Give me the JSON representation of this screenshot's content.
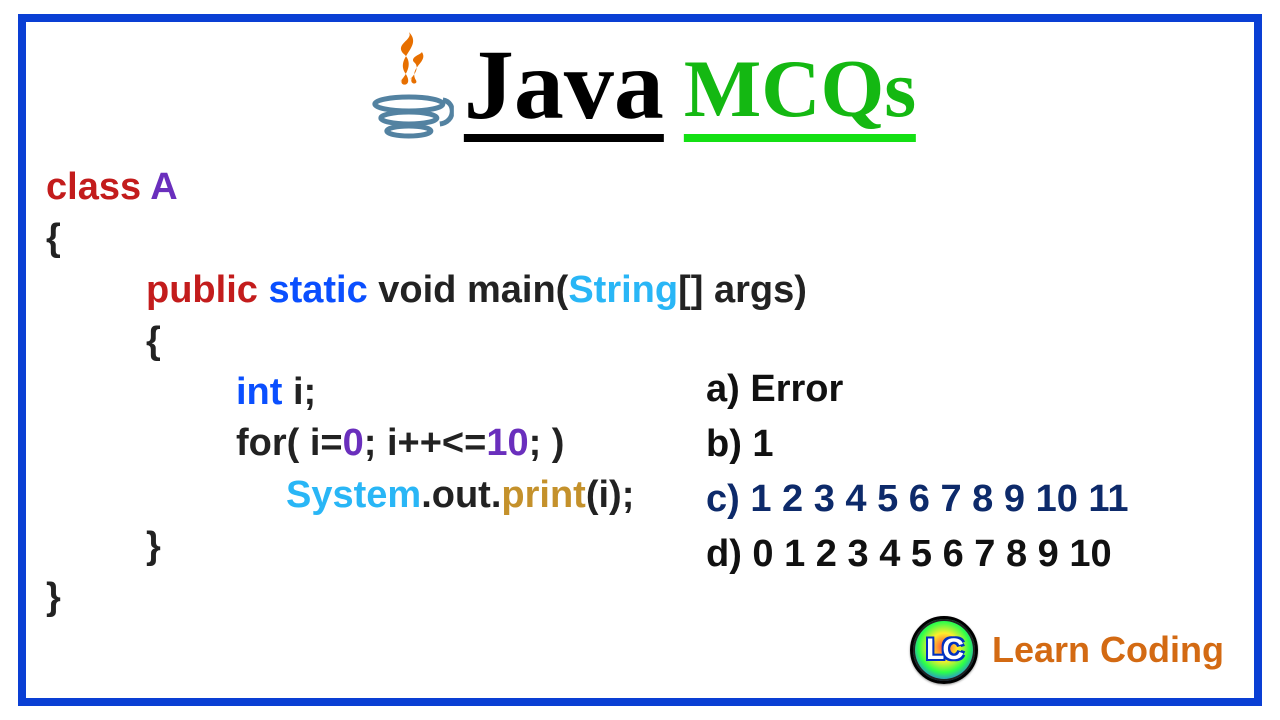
{
  "title": {
    "java": "Java",
    "mcqs": "MCQs"
  },
  "code": {
    "l1a": "class ",
    "l1b": "A",
    "l2": "{",
    "l3a": "public ",
    "l3b": "static ",
    "l3c": "void ",
    "l3d": "main(",
    "l3e": "String",
    "l3f": "[] ",
    "l3g": "args)",
    "l4": "{",
    "l5a": "int ",
    "l5b": "i;",
    "l6a": "for",
    "l6b": "( i=",
    "l6n1": "0",
    "l6c": "; i++<=",
    "l6n2": "10",
    "l6d": "; )",
    "l7a": "System",
    "l7b": ".out.",
    "l7c": "print",
    "l7d": "(i);",
    "l8": "}",
    "l9": "}"
  },
  "options": {
    "a": "a) Error",
    "b": "b) 1",
    "c": "c) 1 2 3 4 5 6 7 8 9 10 11",
    "d": "d) 0 1 2 3 4 5 6 7 8 9 10"
  },
  "brand": {
    "initials": "LC",
    "name": "Learn Coding"
  }
}
